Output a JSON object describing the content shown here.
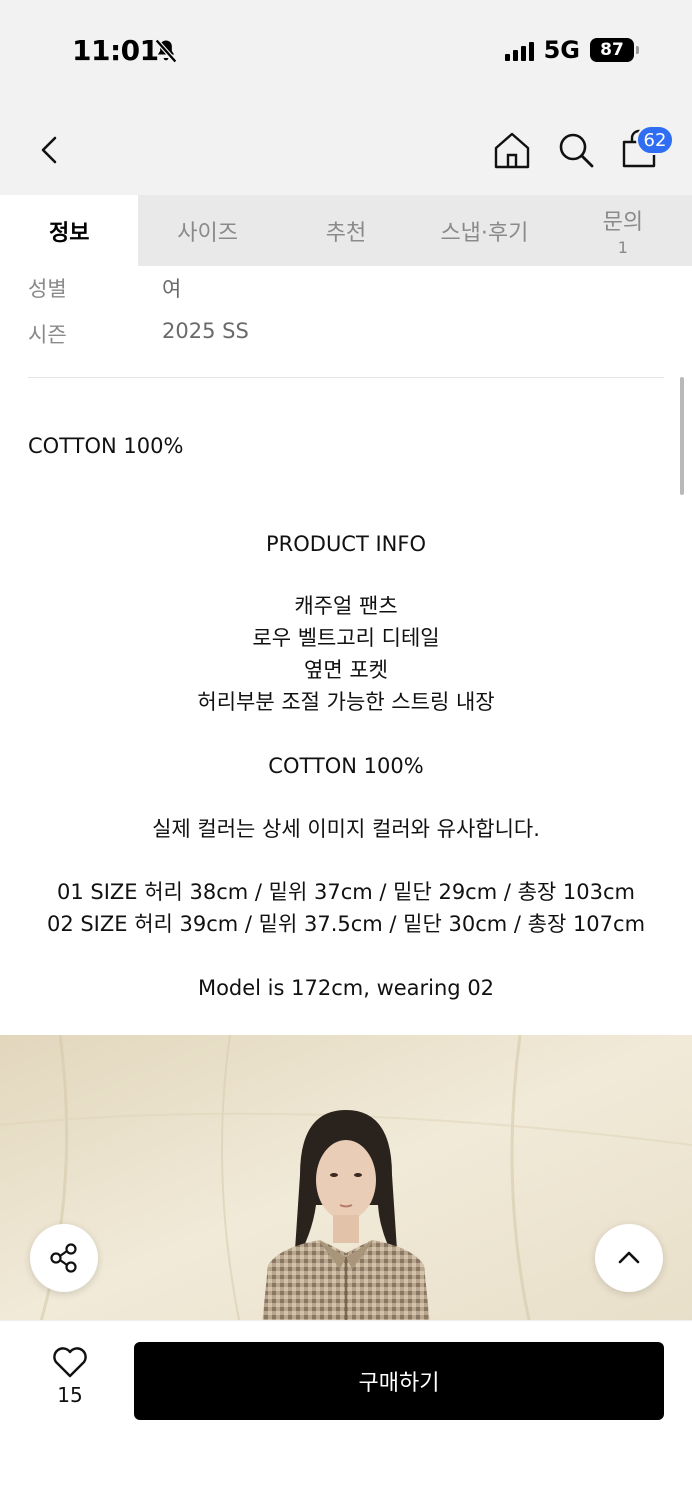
{
  "status_bar": {
    "time": "11:01",
    "network": "5G",
    "battery": "87"
  },
  "nav": {
    "cart_count": "62"
  },
  "tabs": [
    {
      "label": "정보",
      "sub": ""
    },
    {
      "label": "사이즈",
      "sub": ""
    },
    {
      "label": "추천",
      "sub": ""
    },
    {
      "label": "스냅·후기",
      "sub": ""
    },
    {
      "label": "문의",
      "sub": "1"
    }
  ],
  "info": [
    {
      "key": "성별",
      "value": "여"
    },
    {
      "key": "시즌",
      "value": "2025 SS"
    }
  ],
  "material": "COTTON 100%",
  "description": {
    "heading": "PRODUCT INFO",
    "features": [
      "캐주얼 팬츠",
      "로우 벨트고리 디테일",
      "옆면 포켓",
      "허리부분 조절 가능한 스트링 내장"
    ],
    "material": "COTTON 100%",
    "color_note": "실제 컬러는 상세 이미지 컬러와 유사합니다.",
    "sizes": [
      "01 SIZE 허리 38cm / 밑위 37cm / 밑단 29cm / 총장 103cm",
      "02 SIZE 허리 39cm / 밑위 37.5cm / 밑단 30cm / 총장 107cm"
    ],
    "model": "Model is 172cm, wearing 02"
  },
  "bottom": {
    "like_count": "15",
    "buy_label": "구매하기"
  }
}
